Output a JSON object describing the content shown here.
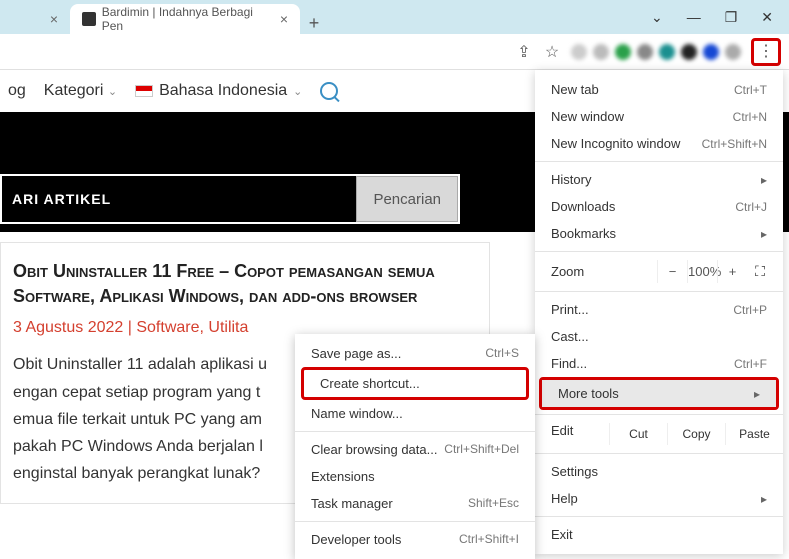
{
  "tabs": {
    "active_title": "Bardimin | Indahnya Berbagi Pen"
  },
  "nav": {
    "item1": "og",
    "item2": "Kategori",
    "item3": "Bahasa Indonesia"
  },
  "search": {
    "label": "ARI ARTIKEL",
    "button": "Pencarian"
  },
  "article": {
    "title": "Obit Uninstaller 11 Free – Copot pemasangan semua Software, Aplikasi Windows, dan add-ons browser",
    "meta": "3 Agustus 2022 | Software, Utilita",
    "body": "Obit Uninstaller 11 adalah aplikasi u\nengan cepat setiap program yang t\nemua file terkait untuk PC yang am\npakah PC Windows Anda berjalan l\nenginstal banyak perangkat lunak?"
  },
  "menu": {
    "new_tab": "New tab",
    "new_tab_sc": "Ctrl+T",
    "new_window": "New window",
    "new_window_sc": "Ctrl+N",
    "new_incognito": "New Incognito window",
    "new_incognito_sc": "Ctrl+Shift+N",
    "history": "History",
    "downloads": "Downloads",
    "downloads_sc": "Ctrl+J",
    "bookmarks": "Bookmarks",
    "zoom": "Zoom",
    "zoom_val": "100%",
    "print": "Print...",
    "print_sc": "Ctrl+P",
    "cast": "Cast...",
    "find": "Find...",
    "find_sc": "Ctrl+F",
    "more_tools": "More tools",
    "edit": "Edit",
    "cut": "Cut",
    "copy": "Copy",
    "paste": "Paste",
    "settings": "Settings",
    "help": "Help",
    "exit": "Exit"
  },
  "submenu": {
    "save_page": "Save page as...",
    "save_page_sc": "Ctrl+S",
    "create_shortcut": "Create shortcut...",
    "name_window": "Name window...",
    "clear_browsing": "Clear browsing data...",
    "clear_browsing_sc": "Ctrl+Shift+Del",
    "extensions": "Extensions",
    "task_manager": "Task manager",
    "task_manager_sc": "Shift+Esc",
    "dev_tools": "Developer tools",
    "dev_tools_sc": "Ctrl+Shift+I"
  }
}
